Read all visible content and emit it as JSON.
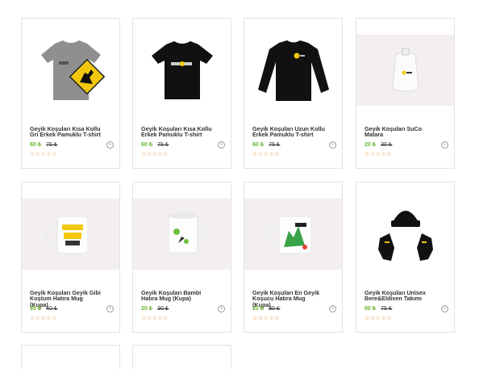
{
  "products": [
    {
      "name": "Geyik Koşuları Kısa Kollu Gri Erkek Pamuklu T-shirt",
      "price": "60 ₺",
      "old_price": "75 ₺",
      "stars": "☆☆☆☆☆",
      "image": "grey-tshirt-deer",
      "image_bg": "#ffffff"
    },
    {
      "name": "Geyik Koşuları Kısa Kollu Erkek Pamuklu T-shirt",
      "price": "60 ₺",
      "old_price": "75 ₺",
      "stars": "☆☆☆☆☆",
      "image": "black-tshirt-logo",
      "image_bg": "#ffffff"
    },
    {
      "name": "Geyik Koşuları Uzun Kollu Erkek Pamuklu T-shirt",
      "price": "60 ₺",
      "old_price": "75 ₺",
      "stars": "☆☆☆☆☆",
      "image": "black-longsleeve",
      "image_bg": "#ffffff"
    },
    {
      "name": "Geyik Koşuları SuCo Matara",
      "price": "20 ₺",
      "old_price": "30 ₺",
      "stars": "☆☆☆☆☆",
      "image": "water-pouch",
      "image_bg": "#f2efee"
    },
    {
      "name": "Geyik Koşuları Geyik Gibi Koştum Hatıra Mug (Kupa)",
      "price": "35 ₺",
      "old_price": "40 ₺",
      "stars": "☆☆☆☆☆",
      "image": "mug-yellow-text",
      "image_bg": "#f2efee"
    },
    {
      "name": "Geyik Koşuları Bambi Hatıra Mug (Kupa)",
      "price": "20 ₺",
      "old_price": "30 ₺",
      "stars": "☆☆☆☆☆",
      "image": "mug-bambi",
      "image_bg": "#f2efee"
    },
    {
      "name": "Geyik Koşuları En Geyik Koşucu Hatıra Mug (Kupa)",
      "price": "20 ₺",
      "old_price": "30 ₺",
      "stars": "☆☆☆☆☆",
      "image": "mug-green",
      "image_bg": "#f2efee"
    },
    {
      "name": "Geyik Koşuları Unisex Bere&Eldiven Takımı",
      "price": "60 ₺",
      "old_price": "75 ₺",
      "stars": "☆☆☆☆☆",
      "image": "beanie-gloves",
      "image_bg": "#ffffff"
    }
  ],
  "cart_icon": "cart-plus-icon",
  "colors": {
    "price": "#66b32e",
    "stars": "#e0842b",
    "brand_yellow": "#f2c80f"
  }
}
